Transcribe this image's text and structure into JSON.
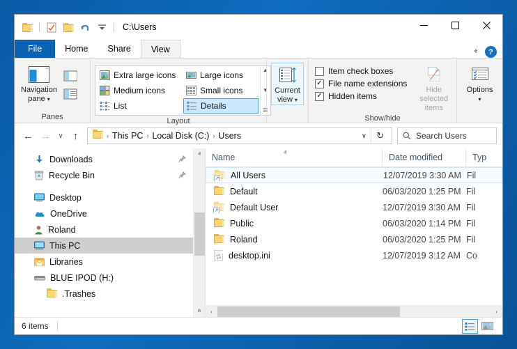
{
  "window": {
    "title": "C:\\Users",
    "controls": {
      "minimize": "—",
      "maximize": "□",
      "close": "✕"
    }
  },
  "quick_access": [
    {
      "name": "folder-icon",
      "label": "Folder"
    },
    {
      "name": "properties-icon",
      "label": "Properties"
    },
    {
      "name": "new-folder-icon",
      "label": "New folder"
    },
    {
      "name": "undo-icon",
      "label": "Undo"
    },
    {
      "name": "customize-qat-icon",
      "label": "Customize Quick Access Toolbar"
    }
  ],
  "tabs": [
    {
      "label": "File",
      "active": false,
      "file": true
    },
    {
      "label": "Home",
      "active": false
    },
    {
      "label": "Share",
      "active": false
    },
    {
      "label": "View",
      "active": true
    }
  ],
  "ribbon_right": {
    "collapse": "ⱏ",
    "help": "?"
  },
  "ribbon": {
    "panes": {
      "label": "Panes",
      "navigation_pane": "Navigation\npane",
      "navigation_pane_line1": "Navigation",
      "navigation_pane_line2": "pane",
      "preview_pane": "Preview pane",
      "details_pane": "Details pane"
    },
    "layout": {
      "label": "Layout",
      "items": [
        {
          "label": "Extra large icons",
          "selected": false
        },
        {
          "label": "Large icons",
          "selected": false
        },
        {
          "label": "Medium icons",
          "selected": false
        },
        {
          "label": "Small icons",
          "selected": false
        },
        {
          "label": "List",
          "selected": false
        },
        {
          "label": "Details",
          "selected": true
        }
      ]
    },
    "current_view": {
      "label_line1": "Current",
      "label_line2": "view",
      "dropdown": "▾"
    },
    "show_hide": {
      "label": "Show/hide",
      "checks": [
        {
          "label": "Item check boxes",
          "checked": false
        },
        {
          "label": "File name extensions",
          "checked": true
        },
        {
          "label": "Hidden items",
          "checked": true
        }
      ],
      "hide_selected_line1": "Hide selected",
      "hide_selected_line2": "items"
    },
    "options": {
      "label": "Options",
      "dropdown": "▾"
    }
  },
  "address_bar": {
    "back": "←",
    "forward": "→",
    "recent": "∨",
    "up": "↑",
    "breadcrumbs": [
      "This PC",
      "Local Disk (C:)",
      "Users"
    ],
    "separator": "›",
    "dropdown": "∨",
    "refresh": "↻"
  },
  "search": {
    "placeholder": "Search Users",
    "icon": "search-icon"
  },
  "sidebar": {
    "items": [
      {
        "label": "Downloads",
        "icon": "downloads-icon",
        "pinned": true,
        "selected": false,
        "indent": 0
      },
      {
        "label": "Recycle Bin",
        "icon": "recycle-bin-icon",
        "pinned": true,
        "selected": false,
        "indent": 0
      },
      {
        "label": "Desktop",
        "icon": "desktop-icon",
        "pinned": false,
        "selected": false,
        "indent": 0,
        "gap_before": true
      },
      {
        "label": "OneDrive",
        "icon": "onedrive-icon",
        "pinned": false,
        "selected": false,
        "indent": 0
      },
      {
        "label": "Roland",
        "icon": "user-icon",
        "pinned": false,
        "selected": false,
        "indent": 0
      },
      {
        "label": "This PC",
        "icon": "this-pc-icon",
        "pinned": false,
        "selected": true,
        "indent": 0
      },
      {
        "label": "Libraries",
        "icon": "libraries-icon",
        "pinned": false,
        "selected": false,
        "indent": 0
      },
      {
        "label": "BLUE IPOD (H:)",
        "icon": "drive-icon",
        "pinned": false,
        "selected": false,
        "indent": 0
      },
      {
        "label": ".Trashes",
        "icon": "folder-icon",
        "pinned": false,
        "selected": false,
        "indent": 1
      }
    ],
    "pin_glyph": "📌"
  },
  "file_list": {
    "columns": [
      {
        "label": "Name",
        "sorted": "asc",
        "sort_glyph": "ⱏ"
      },
      {
        "label": "Date modified",
        "sorted": null
      },
      {
        "label": "Typ",
        "sorted": null
      }
    ],
    "rows": [
      {
        "name": "All Users",
        "date": "12/07/2019 3:30 AM",
        "type": "Fil",
        "icon": "folder-shortcut-icon",
        "focused": true
      },
      {
        "name": "Default",
        "date": "06/03/2020 1:25 PM",
        "type": "Fil",
        "icon": "folder-icon",
        "focused": false
      },
      {
        "name": "Default User",
        "date": "12/07/2019 3:30 AM",
        "type": "Fil",
        "icon": "folder-shortcut-icon",
        "focused": false
      },
      {
        "name": "Public",
        "date": "06/03/2020 1:14 PM",
        "type": "Fil",
        "icon": "folder-icon",
        "focused": false
      },
      {
        "name": "Roland",
        "date": "06/03/2020 1:25 PM",
        "type": "Fil",
        "icon": "folder-icon",
        "focused": false
      },
      {
        "name": "desktop.ini",
        "date": "12/07/2019 3:12 AM",
        "type": "Co",
        "icon": "ini-file-icon",
        "focused": false
      }
    ]
  },
  "scrollbars": {
    "up_arrow": "ⱏ",
    "down_arrow": "ⱞ",
    "left_arrow": "‹",
    "right_arrow": "›"
  },
  "status_bar": {
    "item_count": "6 items",
    "view_details": "Details view",
    "view_large_icons": "Large icons view"
  },
  "colors": {
    "accent": "#0b62b0",
    "selection": "#cce8ff",
    "selection_border": "#4aa3e0",
    "nav_selected": "#cfcfcf",
    "ribbon_bg": "#f3f3f3",
    "folder_yellow": "#fbd571",
    "desktop_blue": "#0b5ea8"
  }
}
